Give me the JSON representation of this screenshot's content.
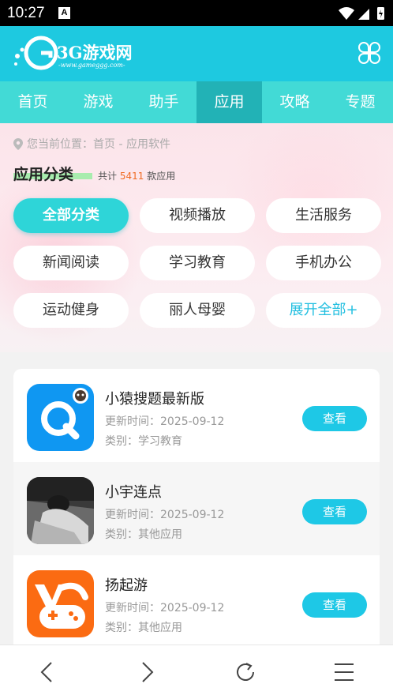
{
  "status_bar": {
    "time": "10:27",
    "notification_icon": "a-icon"
  },
  "header": {
    "logo_text": "3G游戏网",
    "logo_sub": "-www.gameggg.com-",
    "menu_icon": "clover-grid-icon"
  },
  "nav": {
    "items": [
      "首页",
      "游戏",
      "助手",
      "应用",
      "攻略",
      "专题"
    ],
    "active": "应用"
  },
  "breadcrumb": "您当前位置：首页 - 应用软件",
  "category": {
    "title": "应用分类",
    "count_prefix": "共计",
    "count": "5411",
    "count_suffix": "款应用",
    "chips": [
      "全部分类",
      "视频播放",
      "生活服务",
      "新闻阅读",
      "学习教育",
      "手机办公",
      "运动健身",
      "丽人母婴",
      "展开全部+"
    ],
    "active_chip": "全部分类"
  },
  "apps": [
    {
      "name": "小猿搜题最新版",
      "date": "更新时间：2025-09-12",
      "category": "类别：学习教育",
      "button": "查看"
    },
    {
      "name": "小宇连点",
      "date": "更新时间：2025-09-12",
      "category": "类别：其他应用",
      "button": "查看"
    },
    {
      "name": "扬起游",
      "date": "更新时间：2025-09-12",
      "category": "类别：其他应用",
      "button": "查看"
    }
  ],
  "bottom_bar": [
    "back-icon",
    "forward-icon",
    "reload-icon",
    "menu-icon"
  ],
  "colors": {
    "header": "#1ec9e0",
    "nav": "#42dad6",
    "nav_active": "#22b2b6",
    "button": "#1ec8e6",
    "count": "#f06b22"
  }
}
